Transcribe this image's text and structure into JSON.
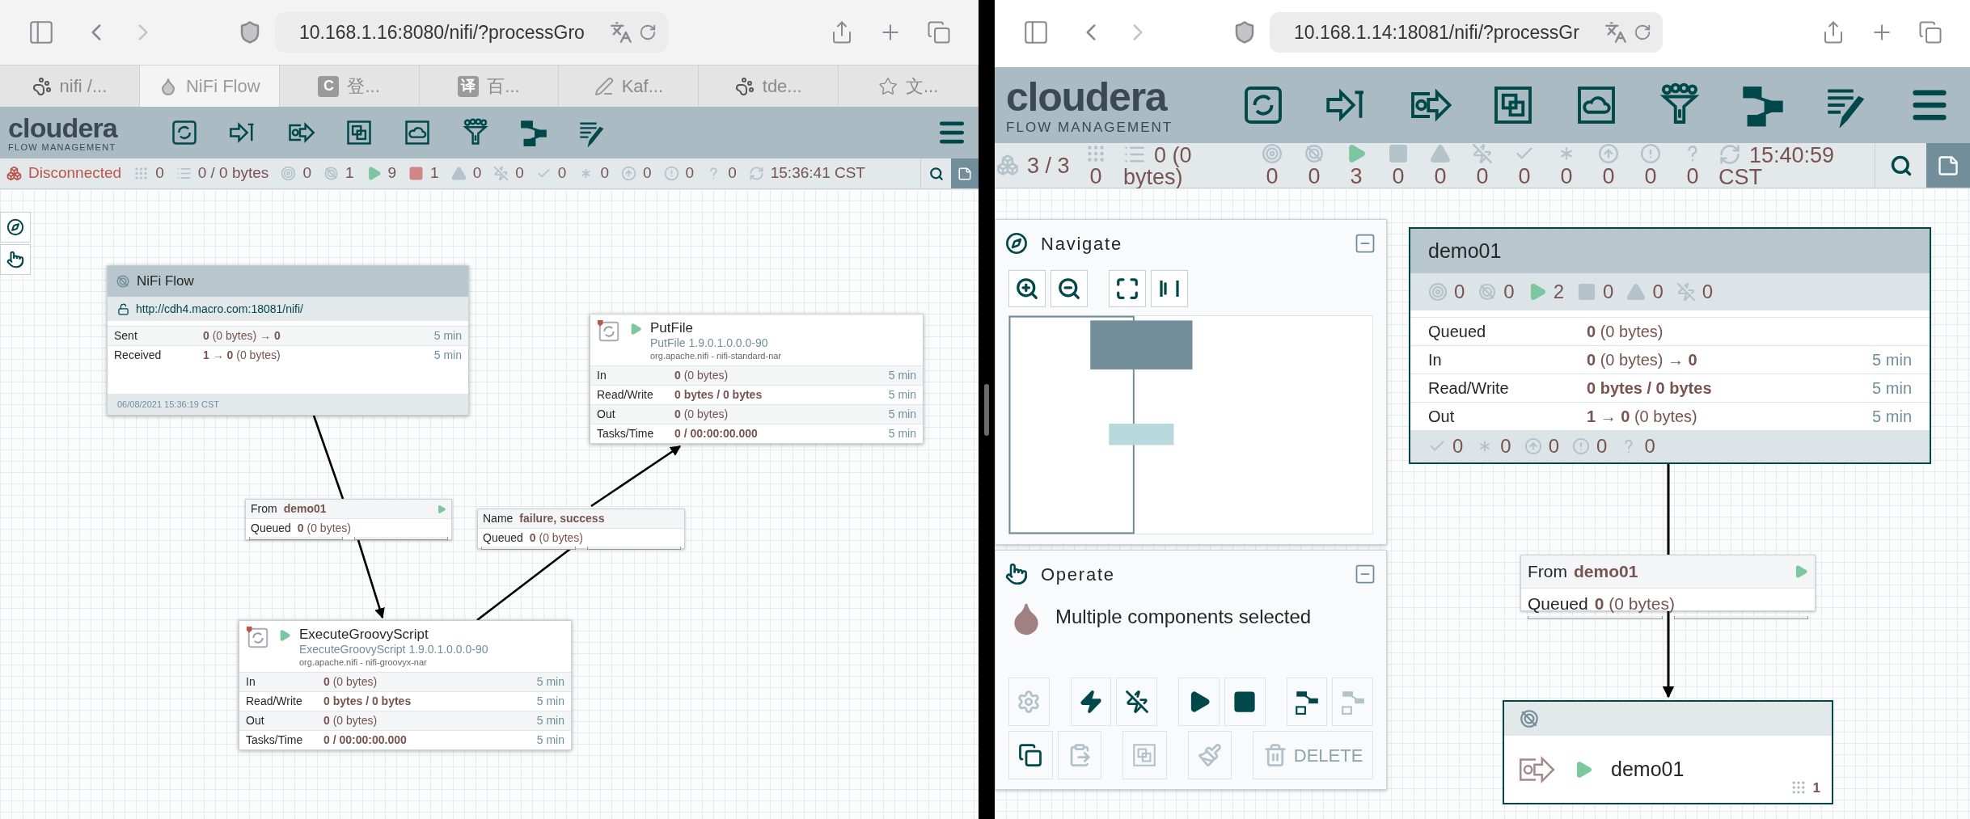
{
  "panes": [
    {
      "url": "10.168.1.16:8080/nifi/?processGro",
      "tabs": [
        {
          "kind": "paw",
          "label": "nifi /...",
          "selected": false
        },
        {
          "kind": "drop",
          "label": "NiFi Flow",
          "selected": true
        },
        {
          "kind": "letter",
          "glyph": "C",
          "label": "登...",
          "selected": false
        },
        {
          "kind": "letter",
          "glyph": "译",
          "label": "百...",
          "selected": false
        },
        {
          "kind": "pen",
          "label": "Kaf...",
          "selected": false
        },
        {
          "kind": "paw",
          "label": "tde...",
          "selected": false
        },
        {
          "kind": "star",
          "label": "文...",
          "selected": false
        }
      ],
      "logo": {
        "name": "cloudera",
        "subtitle": "FLOW MANAGEMENT"
      },
      "status": [
        {
          "kind": "cluster",
          "text": "Disconnected",
          "active": true
        },
        {
          "kind": "threads",
          "text": "0",
          "active": false
        },
        {
          "kind": "queued",
          "text": "0 / 0 bytes",
          "active": false
        },
        {
          "kind": "transmitting",
          "text": "0",
          "active": false
        },
        {
          "kind": "not-transmitting",
          "text": "1",
          "active": false
        },
        {
          "kind": "running",
          "text": "9",
          "active": true
        },
        {
          "kind": "stopped",
          "text": "1",
          "active": true
        },
        {
          "kind": "invalid",
          "text": "0",
          "active": false
        },
        {
          "kind": "disabled",
          "text": "0",
          "active": false
        },
        {
          "kind": "up-to-date",
          "text": "0",
          "active": false
        },
        {
          "kind": "locally-modified",
          "text": "0",
          "active": false
        },
        {
          "kind": "stale",
          "text": "0",
          "active": false
        },
        {
          "kind": "modified-stale",
          "text": "0",
          "active": false
        },
        {
          "kind": "sync-failure",
          "text": "0",
          "active": false
        },
        {
          "kind": "refresh",
          "text": "15:36:41 CST",
          "active": false
        }
      ],
      "palettes": [
        {
          "kind": "navigate",
          "expanded": false
        },
        {
          "kind": "operate",
          "expanded": false
        }
      ],
      "nodes": [
        {
          "kind": "remote-group",
          "name": "NiFi Flow",
          "transmitting": false,
          "selected": false,
          "uri": "http://cdh4.macro.com:18081/nifi/",
          "secure": false,
          "stats": [
            {
              "label": "Sent",
              "value": "**0** (0 bytes) → **0**",
              "window": "5 min"
            },
            {
              "label": "Received",
              "value": "**1** → **0** (0 bytes)",
              "window": "5 min"
            }
          ],
          "footer": "06/08/2021 15:36:19 CST"
        },
        {
          "kind": "processor",
          "name": "PutFile",
          "running": true,
          "selected": false,
          "type": "PutFile 1.9.0.1.0.0.0-90",
          "bundle": "org.apache.nifi - nifi-standard-nar",
          "stats": [
            {
              "label": "In",
              "value": "**0** (0 bytes)",
              "window": "5 min"
            },
            {
              "label": "Read/Write",
              "value": "**0 bytes / 0 bytes**",
              "window": "5 min"
            },
            {
              "label": "Out",
              "value": "**0** (0 bytes)",
              "window": "5 min"
            },
            {
              "label": "Tasks/Time",
              "value": "**0 / 00:00:00.000**",
              "window": "5 min"
            }
          ]
        },
        {
          "kind": "processor",
          "name": "ExecuteGroovyScript",
          "running": true,
          "selected": false,
          "type": "ExecuteGroovyScript 1.9.0.1.0.0.0-90",
          "bundle": "org.apache.nifi - nifi-groovyx-nar",
          "stats": [
            {
              "label": "In",
              "value": "**0** (0 bytes)",
              "window": "5 min"
            },
            {
              "label": "Read/Write",
              "value": "**0 bytes / 0 bytes**",
              "window": "5 min"
            },
            {
              "label": "Out",
              "value": "**0** (0 bytes)",
              "window": "5 min"
            },
            {
              "label": "Tasks/Time",
              "value": "**0 / 00:00:00.000**",
              "window": "5 min"
            }
          ]
        }
      ],
      "connections": [
        {
          "label": "From",
          "value": "demo01",
          "running": true,
          "queued_label": "Queued",
          "queued": "**0** (0 bytes)",
          "bars": [
            {
              "level": 0
            },
            {
              "level": 0
            }
          ]
        },
        {
          "label": "Name",
          "value": "failure, success",
          "running": false,
          "queued_label": "Queued",
          "queued": "**0** (0 bytes)",
          "bars": [
            {
              "level": 0
            },
            {
              "level": 0
            }
          ]
        }
      ]
    },
    {
      "url": "10.168.1.14:18081/nifi/?processGr",
      "logo": {
        "name": "cloudera",
        "subtitle": "FLOW MANAGEMENT"
      },
      "status": [
        {
          "kind": "cluster",
          "text": "3 / 3",
          "active": false
        },
        {
          "kind": "threads",
          "text": "0",
          "active": false
        },
        {
          "kind": "queued",
          "text": "0 (0 bytes)",
          "active": false
        },
        {
          "kind": "transmitting",
          "text": "0",
          "active": false
        },
        {
          "kind": "not-transmitting",
          "text": "0",
          "active": false
        },
        {
          "kind": "running",
          "text": "3",
          "active": true
        },
        {
          "kind": "stopped",
          "text": "0",
          "active": false
        },
        {
          "kind": "invalid",
          "text": "0",
          "active": false
        },
        {
          "kind": "disabled",
          "text": "0",
          "active": false
        },
        {
          "kind": "up-to-date",
          "text": "0",
          "active": false
        },
        {
          "kind": "locally-modified",
          "text": "0",
          "active": false
        },
        {
          "kind": "stale",
          "text": "0",
          "active": false
        },
        {
          "kind": "modified-stale",
          "text": "0",
          "active": false
        },
        {
          "kind": "sync-failure",
          "text": "0",
          "active": false
        },
        {
          "kind": "refresh",
          "text": "15:40:59 CST",
          "active": false
        }
      ],
      "palettes": [
        {
          "kind": "navigate",
          "title": "Navigate",
          "expanded": true
        },
        {
          "kind": "operate",
          "title": "Operate",
          "expanded": true,
          "selection": "Multiple components selected",
          "buttons": [
            {
              "kind": "configure",
              "disabled": true
            },
            {
              "kind": "enable",
              "disabled": false
            },
            {
              "kind": "disable",
              "disabled": false
            },
            {
              "kind": "start",
              "disabled": false
            },
            {
              "kind": "stop",
              "disabled": false
            },
            {
              "kind": "create-template",
              "disabled": false
            },
            {
              "kind": "upload-template",
              "disabled": true
            },
            {
              "kind": "copy",
              "disabled": false
            },
            {
              "kind": "paste",
              "disabled": true
            },
            {
              "kind": "group",
              "disabled": true
            },
            {
              "kind": "color",
              "disabled": true
            },
            {
              "kind": "delete",
              "label": "DELETE",
              "disabled": true
            }
          ]
        }
      ],
      "nodes": [
        {
          "kind": "process-group",
          "name": "demo01",
          "selected": true,
          "counts": [
            {
              "kind": "transmitting",
              "text": "0",
              "active": false
            },
            {
              "kind": "not-transmitting",
              "text": "0",
              "active": false
            },
            {
              "kind": "running",
              "text": "2",
              "active": true
            },
            {
              "kind": "stopped",
              "text": "0",
              "active": false
            },
            {
              "kind": "invalid",
              "text": "0",
              "active": false
            },
            {
              "kind": "disabled",
              "text": "0",
              "active": false
            }
          ],
          "stats": [
            {
              "label": "Queued",
              "value": "**0** (0 bytes)"
            },
            {
              "label": "In",
              "value": "**0** (0 bytes) → **0**",
              "window": "5 min"
            },
            {
              "label": "Read/Write",
              "value": "**0 bytes / 0 bytes**",
              "window": "5 min"
            },
            {
              "label": "Out",
              "value": "**1** → **0** (0 bytes)",
              "window": "5 min"
            }
          ],
          "versions": [
            {
              "kind": "up-to-date",
              "text": "0",
              "active": false
            },
            {
              "kind": "locally-modified",
              "text": "0",
              "active": false
            },
            {
              "kind": "stale",
              "text": "0",
              "active": false
            },
            {
              "kind": "modified-stale",
              "text": "0",
              "active": false
            },
            {
              "kind": "sync-failure",
              "text": "0",
              "active": false
            }
          ]
        },
        {
          "kind": "output-port",
          "name": "demo01",
          "running": true,
          "transmitting": false,
          "selected": true,
          "count": "1"
        }
      ],
      "connections": [
        {
          "label": "From",
          "value": "demo01",
          "running": true,
          "queued_label": "Queued",
          "queued": "**0** (0 bytes)",
          "bars": [
            {
              "level": 0
            },
            {
              "level": 0
            }
          ]
        }
      ]
    }
  ]
}
